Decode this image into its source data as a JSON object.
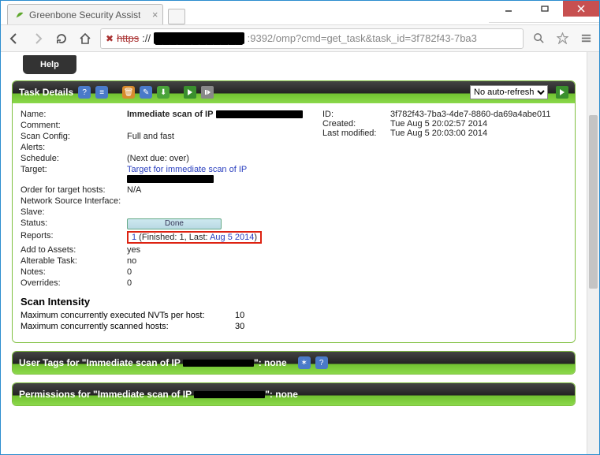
{
  "window": {
    "tab_title": "Greenbone Security Assist"
  },
  "toolbar": {
    "url_prefix": "https",
    "url_port_path": ":9392/omp?cmd=get_task&task_id=3f782f43-7ba3"
  },
  "menu": {
    "help": "Help"
  },
  "panels": {
    "task_details_title": "Task Details",
    "refresh_label": "No auto-refresh",
    "user_tags_title": "User Tags for \"Immediate scan of IP",
    "user_tags_suffix": "\": none",
    "permissions_title": "Permissions for \"Immediate scan of IP",
    "permissions_suffix": "\": none"
  },
  "details": {
    "labels": {
      "name": "Name:",
      "comment": "Comment:",
      "scan_config": "Scan Config:",
      "alerts": "Alerts:",
      "schedule": "Schedule:",
      "target": "Target:",
      "order": "Order for target hosts:",
      "net_if": "Network Source Interface:",
      "slave": "Slave:",
      "status": "Status:",
      "reports": "Reports:",
      "add_assets": "Add to Assets:",
      "alterable": "Alterable Task:",
      "notes": "Notes:",
      "overrides": "Overrides:"
    },
    "values": {
      "name": "Immediate scan of IP",
      "scan_config": "Full and fast",
      "schedule": "(Next due: over)",
      "target": "Target for immediate scan of IP",
      "order": "N/A",
      "status": "Done",
      "reports_count": "1",
      "reports_detail": " (Finished: 1, Last: ",
      "reports_date": "Aug 5 2014",
      "reports_close": ")",
      "add_assets": "yes",
      "alterable": "no",
      "notes": "0",
      "overrides": "0"
    },
    "meta": {
      "id_label": "ID:",
      "id_value": "3f782f43-7ba3-4de7-8860-da69a4abe011",
      "created_label": "Created:",
      "created_value": "Tue Aug 5 20:02:57 2014",
      "modified_label": "Last modified:",
      "modified_value": "Tue Aug 5 20:03:00 2014"
    },
    "scan_intensity": {
      "heading": "Scan Intensity",
      "nvts_label": "Maximum concurrently executed NVTs per host:",
      "nvts_value": "10",
      "hosts_label": "Maximum concurrently scanned hosts:",
      "hosts_value": "30"
    }
  }
}
